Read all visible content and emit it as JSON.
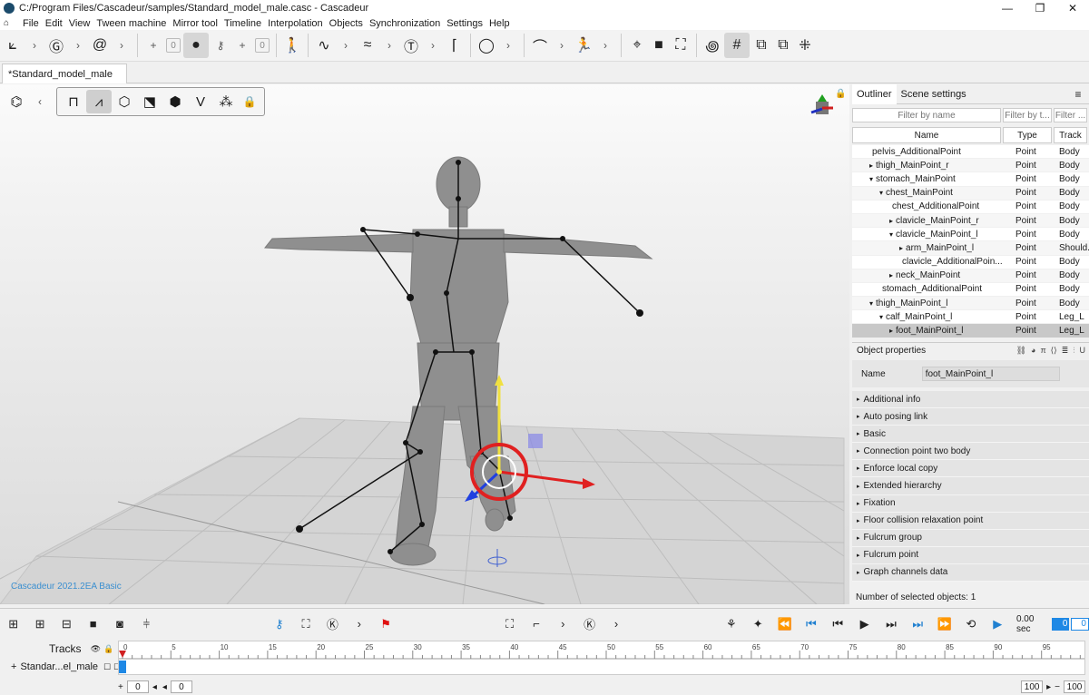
{
  "window": {
    "title": "C:/Program Files/Cascadeur/samples/Standard_model_male.casc - Cascadeur",
    "controls": [
      "—",
      "❐",
      "✕"
    ]
  },
  "menu": [
    "File",
    "Edit",
    "View",
    "Tween machine",
    "Mirror tool",
    "Timeline",
    "Interpolation",
    "Objects",
    "Synchronization",
    "Settings",
    "Help"
  ],
  "toolbar": {
    "left_counter": "0",
    "right_counter": "0"
  },
  "tab": {
    "label": "*Standard_model_male",
    "close": "×"
  },
  "viewport": {
    "watermark": "Cascadeur 2021.2EA Basic",
    "active_mode": "joints"
  },
  "panel": {
    "tabs": [
      "Outliner",
      "Scene settings"
    ],
    "filters": {
      "name_placeholder": "Filter by name",
      "type_placeholder": "Filter by t...",
      "track_placeholder": "Filter ..."
    },
    "columns": [
      "Name",
      "Type",
      "Track"
    ],
    "rows": [
      {
        "name": "pelvis_AdditionalPoint",
        "indent": 1,
        "arrow": "",
        "type": "Point",
        "track": "Body"
      },
      {
        "name": "thigh_MainPoint_r",
        "indent": 1,
        "arrow": "▸",
        "type": "Point",
        "track": "Body"
      },
      {
        "name": "stomach_MainPoint",
        "indent": 1,
        "arrow": "▾",
        "type": "Point",
        "track": "Body"
      },
      {
        "name": "chest_MainPoint",
        "indent": 2,
        "arrow": "▾",
        "type": "Point",
        "track": "Body"
      },
      {
        "name": "chest_AdditionalPoint",
        "indent": 3,
        "arrow": "",
        "type": "Point",
        "track": "Body"
      },
      {
        "name": "clavicle_MainPoint_r",
        "indent": 3,
        "arrow": "▸",
        "type": "Point",
        "track": "Body"
      },
      {
        "name": "clavicle_MainPoint_l",
        "indent": 3,
        "arrow": "▾",
        "type": "Point",
        "track": "Body"
      },
      {
        "name": "arm_MainPoint_l",
        "indent": 4,
        "arrow": "▸",
        "type": "Point",
        "track": "Should..."
      },
      {
        "name": "clavicle_AdditionalPoin...",
        "indent": 4,
        "arrow": "",
        "type": "Point",
        "track": "Body"
      },
      {
        "name": "neck_MainPoint",
        "indent": 3,
        "arrow": "▸",
        "type": "Point",
        "track": "Body"
      },
      {
        "name": "stomach_AdditionalPoint",
        "indent": 2,
        "arrow": "",
        "type": "Point",
        "track": "Body"
      },
      {
        "name": "thigh_MainPoint_l",
        "indent": 1,
        "arrow": "▾",
        "type": "Point",
        "track": "Body"
      },
      {
        "name": "calf_MainPoint_l",
        "indent": 2,
        "arrow": "▾",
        "type": "Point",
        "track": "Leg_L"
      },
      {
        "name": "foot_MainPoint_l",
        "indent": 3,
        "arrow": "▸",
        "type": "Point",
        "track": "Leg_L"
      }
    ],
    "object_properties": {
      "title": "Object properties",
      "name_label": "Name",
      "name_value": "foot_MainPoint_l",
      "sections": [
        "Additional info",
        "Auto posing link",
        "Basic",
        "Connection point two body",
        "Enforce local copy",
        "Extended hierarchy",
        "Fixation",
        "Floor collision relaxation point",
        "Fulcrum group",
        "Fulcrum point",
        "Graph channels data"
      ]
    },
    "selected_count": "Number of selected objects: 1"
  },
  "playback": {
    "time": "0.00 sec",
    "frame": "0",
    "end": "0"
  },
  "timeline": {
    "tracks_label": "Tracks",
    "ruler_ticks": [
      "0",
      "5",
      "10",
      "15",
      "20",
      "25",
      "30",
      "35",
      "40",
      "45",
      "50",
      "55",
      "60",
      "65",
      "70",
      "75",
      "80",
      "85",
      "90",
      "95"
    ],
    "track_name": "Standar...el_male",
    "start": "0",
    "current": "0",
    "end_box": "100",
    "end_right": "100"
  }
}
